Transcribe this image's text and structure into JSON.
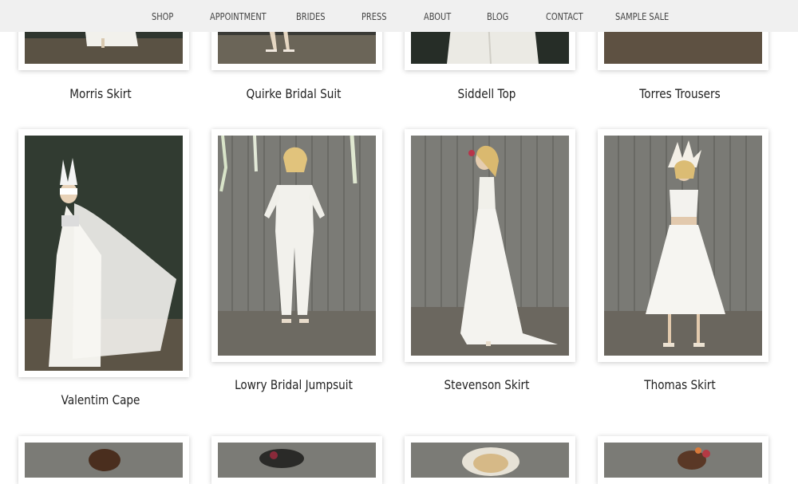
{
  "nav": {
    "items": [
      {
        "label": "SHOP"
      },
      {
        "label": "APPOINTMENT"
      },
      {
        "label": "BRIDES"
      },
      {
        "label": "PRESS"
      },
      {
        "label": "ABOUT"
      },
      {
        "label": "BLOG"
      },
      {
        "label": "CONTACT"
      },
      {
        "label": "SAMPLE SALE"
      }
    ]
  },
  "products": {
    "row1": [
      {
        "name": "Morris Skirt"
      },
      {
        "name": "Quirke Bridal Suit"
      },
      {
        "name": "Siddell Top"
      },
      {
        "name": "Torres Trousers"
      }
    ],
    "row2": [
      {
        "name": "Valentim Cape"
      },
      {
        "name": "Lowry Bridal Jumpsuit"
      },
      {
        "name": "Stevenson Skirt"
      },
      {
        "name": "Thomas Skirt"
      }
    ]
  },
  "colors": {
    "nav_bg": "#f0f0f0",
    "wood_wall": "#7d7d78",
    "dark_wall": "#2e352e",
    "floor": "#6e6a60",
    "dress": "#f4f3ef"
  }
}
